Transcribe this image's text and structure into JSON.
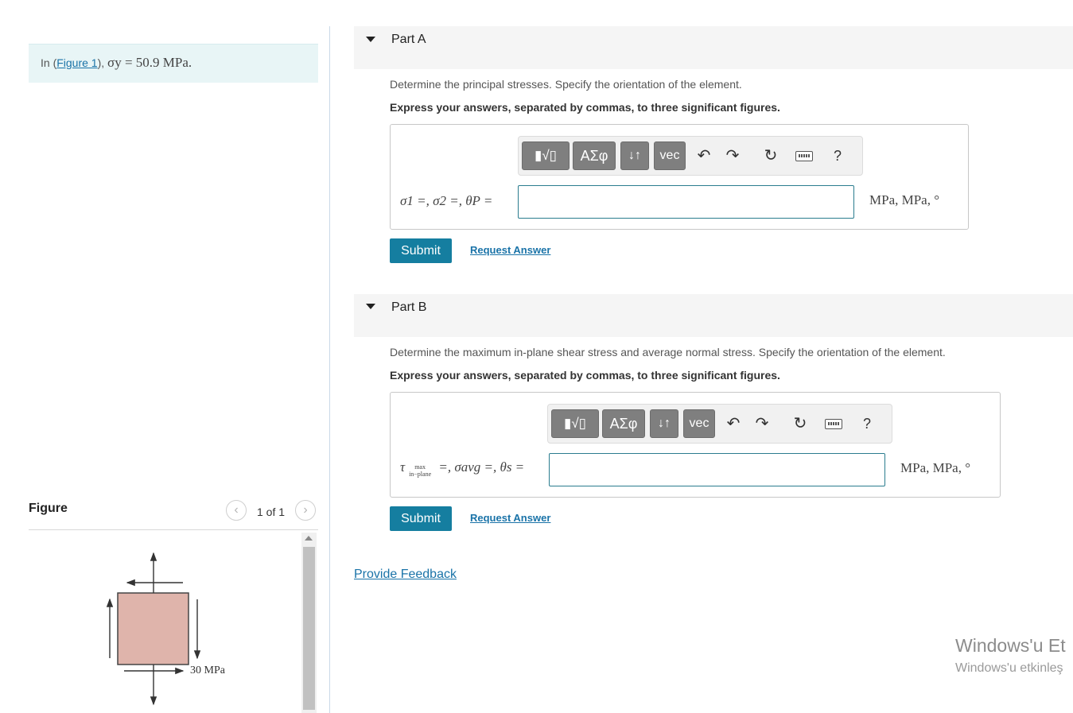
{
  "intro": {
    "prefix": "In (",
    "figure_link": "Figure 1",
    "suffix": "), ",
    "condition": "σy = 50.9 MPa."
  },
  "figure": {
    "title": "Figure",
    "counter": "1 of 1",
    "stress_label": "30 MPa",
    "colors": {
      "element_fill": "#dfb4ab"
    }
  },
  "part_a": {
    "label": "Part A",
    "question": "Determine the principal stresses. Specify the orientation of the element.",
    "instruction": "Express your answers, separated by commas, to three significant figures.",
    "toolbar": {
      "templates": "▮√▯",
      "greek": "ΑΣφ",
      "arrows": "↓↑",
      "vec": "vec",
      "help": "?"
    },
    "equation": "σ1 =, σ2 =, θP =",
    "input_value": "",
    "units": "MPa, MPa, °",
    "submit": "Submit",
    "request": "Request Answer"
  },
  "part_b": {
    "label": "Part B",
    "question": "Determine the maximum in-plane shear stress and average normal stress. Specify the orientation of the element.",
    "instruction": "Express your answers, separated by commas, to three significant figures.",
    "toolbar": {
      "templates": "▮√▯",
      "greek": "ΑΣφ",
      "arrows": "↓↑",
      "vec": "vec",
      "help": "?"
    },
    "tau": "τ",
    "tau_sub_top": "max",
    "tau_sub_bottom": "in−plane",
    "equation_rest": "=, σavg =, θs =",
    "input_value": "",
    "units": "MPa, MPa, °",
    "submit": "Submit",
    "request": "Request Answer"
  },
  "feedback": "Provide Feedback",
  "watermark": {
    "line1": "Windows'u Et",
    "line2": "Windows'u etkinleş"
  },
  "colors": {
    "accent": "#157ea0",
    "link": "#1a73a8",
    "intro_bg": "#e8f5f6"
  }
}
